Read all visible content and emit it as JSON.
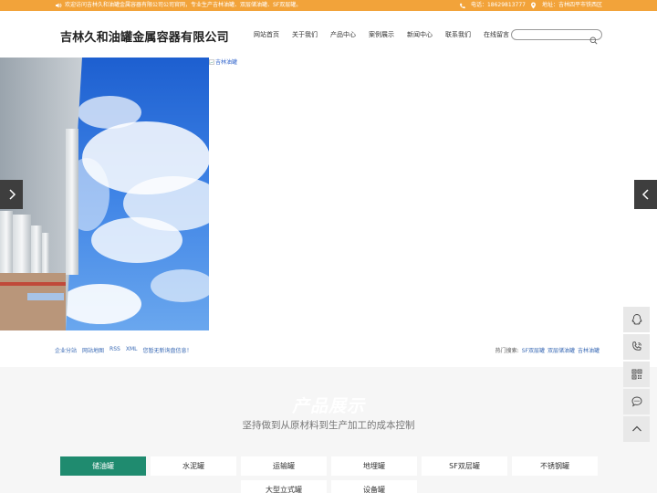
{
  "topbar": {
    "welcome": "欢迎访问吉林久和油罐金属容器有限公司公司官网，专业生产吉林油罐、双层储油罐、SF双层罐。",
    "phone_label": "电话：",
    "phone": "18629813777",
    "address_label": "地址：",
    "address": "吉林四平市铁西区"
  },
  "header": {
    "logo": "吉林久和油罐金属容器有限公司",
    "nav": [
      "网站首页",
      "关于我们",
      "产品中心",
      "案例展示",
      "新闻中心",
      "联系我们",
      "在线留言"
    ],
    "search_placeholder": ""
  },
  "banner": {
    "broken_image_alt": "吉林油罐"
  },
  "links": {
    "left": [
      "企业分站",
      "网站地图",
      "RSS",
      "XML",
      "您暂无新询盘信息！"
    ],
    "hot_label": "热门搜索:",
    "hot": [
      "SF双层罐",
      "双层储油罐",
      "吉林油罐"
    ]
  },
  "products": {
    "title": "产品展示",
    "subtitle": "坚持做到从原材料到生产加工的成本控制",
    "tabs": [
      "储油罐",
      "水泥罐",
      "运输罐",
      "地埋罐",
      "SF双层罐",
      "不锈钢罐",
      "大型立式罐",
      "设备罐"
    ],
    "active_tab": 0
  },
  "float_bar": [
    "qq-icon",
    "phone-icon",
    "qrcode-icon",
    "message-icon",
    "back-to-top-icon"
  ],
  "colors": {
    "topbar": "#f2a33a",
    "active_tab": "#1f8b6f",
    "link": "#3a6ab5"
  }
}
